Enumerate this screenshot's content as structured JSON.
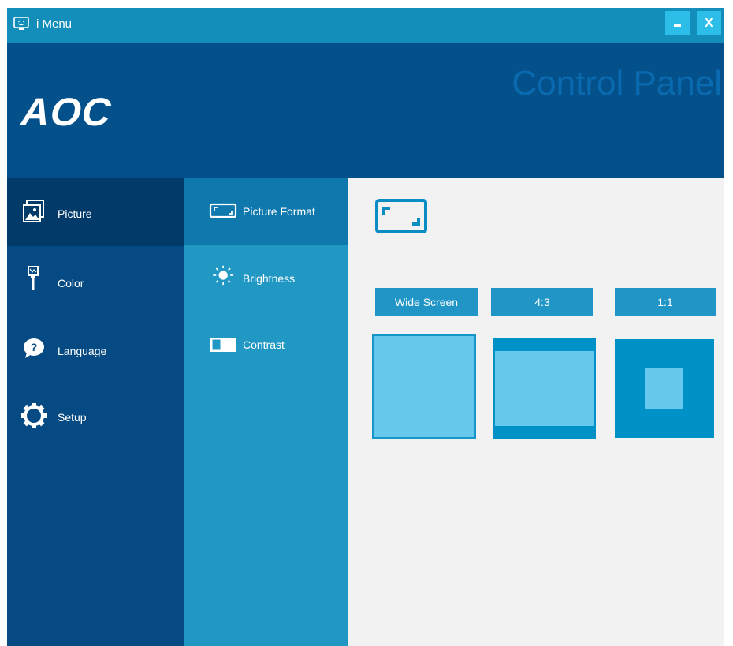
{
  "app": {
    "title": "i Menu",
    "minimize": "-",
    "close": "X"
  },
  "header": {
    "logo": "AOC",
    "panel_title": "Control Panel"
  },
  "left_nav": [
    {
      "label": "Picture",
      "icon": "picture-icon",
      "active": true
    },
    {
      "label": "Color",
      "icon": "color-brush-icon",
      "active": false
    },
    {
      "label": "Language",
      "icon": "language-bubble-icon",
      "active": false
    },
    {
      "label": "Setup",
      "icon": "gear-icon",
      "active": false
    }
  ],
  "sub_nav": [
    {
      "label": "Picture Format",
      "icon": "picture-format-icon",
      "active": true
    },
    {
      "label": "Brightness",
      "icon": "sun-icon",
      "active": false
    },
    {
      "label": "Contrast",
      "icon": "contrast-icon",
      "active": false
    }
  ],
  "content": {
    "options": [
      "Wide Screen",
      "4:3",
      "1:1"
    ],
    "selected_option": "Wide Screen"
  },
  "colors": {
    "title_bar": "#138eba",
    "header": "#04508a",
    "nav_active": "#023a69",
    "subnav": "#2197c4",
    "subnav_active": "#0f78ad",
    "accent": "#2196c6",
    "preview_light": "#67c8ee",
    "preview_dark": "#0092c6"
  }
}
